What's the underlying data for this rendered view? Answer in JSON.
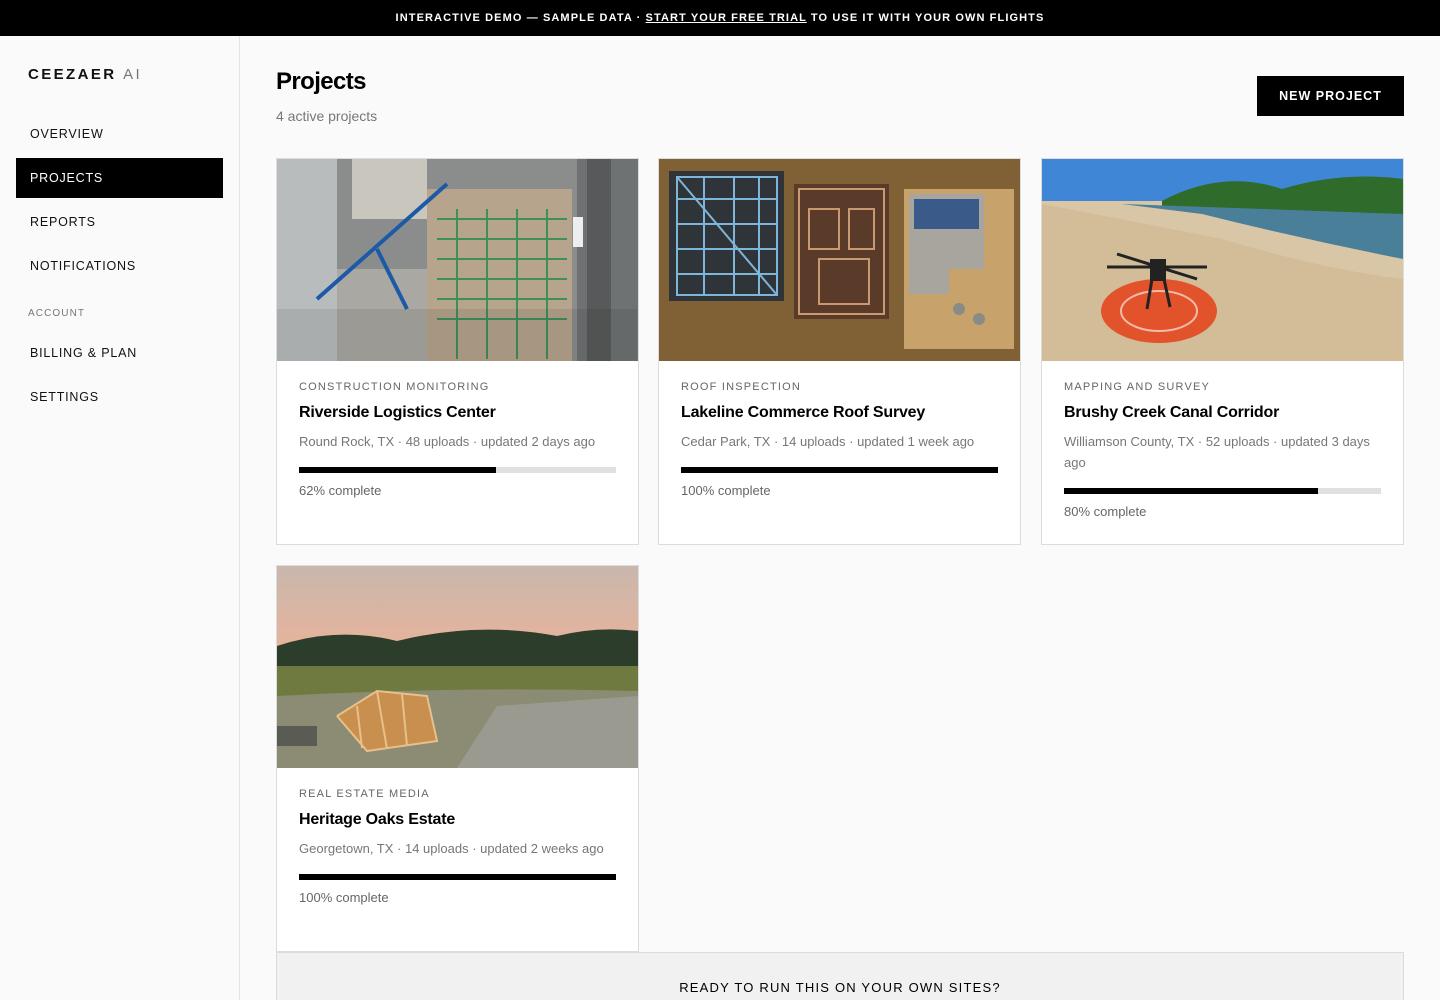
{
  "banner": {
    "prefix": "INTERACTIVE DEMO — SAMPLE DATA · ",
    "link": "START YOUR FREE TRIAL",
    "suffix": " TO USE IT WITH YOUR OWN FLIGHTS"
  },
  "sidebar": {
    "brand": "CEEZAER",
    "brand_suffix": "AI",
    "items": [
      {
        "label": "OVERVIEW"
      },
      {
        "label": "PROJECTS",
        "active": true
      },
      {
        "label": "REPORTS"
      },
      {
        "label": "NOTIFICATIONS"
      }
    ],
    "account_heading": "ACCOUNT",
    "account_items": [
      {
        "label": "BILLING & PLAN"
      },
      {
        "label": "SETTINGS"
      }
    ]
  },
  "header": {
    "title": "Projects",
    "subtitle": "4 active projects",
    "new_button": "NEW PROJECT"
  },
  "projects": [
    {
      "category": "CONSTRUCTION MONITORING",
      "name": "Riverside Logistics Center",
      "meta": "Round Rock, TX · 48 uploads · updated 2 days ago",
      "progress": 62,
      "progress_label": "62% complete",
      "image": "aerial-construction-site-crane"
    },
    {
      "category": "ROOF INSPECTION",
      "name": "Lakeline Commerce Roof Survey",
      "meta": "Cedar Park, TX · 14 uploads · updated 1 week ago",
      "progress": 100,
      "progress_label": "100% complete",
      "image": "aerial-building-framing"
    },
    {
      "category": "MAPPING AND SURVEY",
      "name": "Brushy Creek Canal Corridor",
      "meta": "Williamson County, TX · 52 uploads · updated 3 days ago",
      "progress": 80,
      "progress_label": "80% complete",
      "image": "drone-on-landing-pad-canal"
    },
    {
      "category": "REAL ESTATE MEDIA",
      "name": "Heritage Oaks Estate",
      "meta": "Georgetown, TX · 14 uploads · updated 2 weeks ago",
      "progress": 100,
      "progress_label": "100% complete",
      "image": "house-framing-sunset"
    }
  ],
  "cta": {
    "text": "READY TO RUN THIS ON YOUR OWN SITES?"
  }
}
